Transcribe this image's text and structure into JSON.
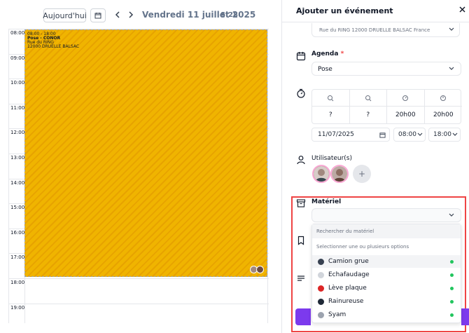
{
  "toolbar": {
    "today_label": "Aujourd'hui",
    "date_title": "Vendredi 11 juillet 2025",
    "week_label": "S.28"
  },
  "calendar": {
    "hours": [
      "08:00",
      "09:00",
      "10:00",
      "11:00",
      "12:00",
      "13:00",
      "14:00",
      "15:00",
      "16:00",
      "17:00",
      "18:00",
      "19:00"
    ],
    "event": {
      "time": "08:00 - 18:00",
      "title": "Pose - CONOR",
      "address_line1": "Rue du RING",
      "address_line2": "12000 DRUELLE BALSAC",
      "color": "#f0b400"
    }
  },
  "panel": {
    "title": "Ajouter un événement",
    "address": "Rue du RING 12000 DRUELLE BALSAC France",
    "agenda": {
      "label": "Agenda",
      "required_mark": "*",
      "value": "Pose"
    },
    "duration": {
      "values": [
        "?",
        "?",
        "20h00",
        "20h00"
      ]
    },
    "date": {
      "value": "11/07/2025",
      "start": "08:00",
      "end": "18:00"
    },
    "users": {
      "label": "Utilisateur(s)",
      "add": "+"
    },
    "material": {
      "label": "Matériel",
      "search_placeholder": "Rechercher du matériel",
      "hint": "Selectionner une ou plusieurs options",
      "options": [
        {
          "label": "Camion grue",
          "icon": "truck-icon",
          "status_color": "#22c55e"
        },
        {
          "label": "Echafaudage",
          "icon": "scaffold-icon",
          "status_color": "#22c55e"
        },
        {
          "label": "Lève plaque",
          "icon": "lift-icon",
          "status_color": "#22c55e"
        },
        {
          "label": "Rainureuse",
          "icon": "grinder-icon",
          "status_color": "#22c55e"
        },
        {
          "label": "Syam",
          "icon": "tool-icon",
          "status_color": "#22c55e"
        }
      ]
    },
    "accent_color": "#7c3aed",
    "highlight_color": "#ef4444"
  }
}
